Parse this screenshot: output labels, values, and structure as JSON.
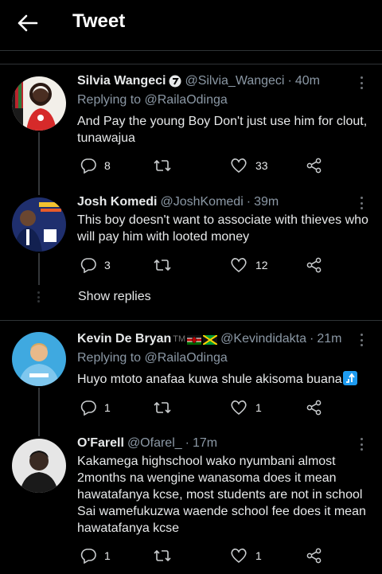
{
  "header": {
    "title": "Tweet"
  },
  "colors": {
    "accent": "#1d9bf0",
    "muted": "#8b98a5",
    "background": "#000000",
    "divider": "#2f3336"
  },
  "tweets": [
    {
      "name": "Silvia Wangeci",
      "verified_badge": "circle-badge",
      "handle": "@Silvia_Wangeci",
      "sep": "·",
      "time": "40m",
      "replying_prefix": "Replying to",
      "replying_to": "@RailaOdinga",
      "text": "And Pay the young Boy Don't just use him for clout, tunawajua",
      "replies": "8",
      "retweets": "",
      "likes": "33"
    },
    {
      "name": "Josh Komedi",
      "handle": "@JoshKomedi",
      "sep": "·",
      "time": "39m",
      "text": "This boy doesn't want to associate with thieves who will pay him with looted money",
      "replies": "3",
      "retweets": "",
      "likes": "12"
    },
    {
      "name": "Kevin De Bryan",
      "name_suffix": "TM",
      "flags": [
        "kenya-flag",
        "jamaica-flag"
      ],
      "handle": "@Kevindidakta",
      "sep": "·",
      "time": "21m",
      "replying_prefix": "Replying to",
      "replying_to": "@RailaOdinga",
      "text": "Huyo mtoto anafaa kuwa shule akisoma buana",
      "emoji": "up-arrow-emoji",
      "replies": "1",
      "retweets": "",
      "likes": "1"
    },
    {
      "name": "O'Farell",
      "handle": "@Ofarel_",
      "sep": "·",
      "time": "17m",
      "text": "Kakamega highschool wako nyumbani almost 2months na wengine wanasoma does it mean hawatafanya kcse, most students are not in school Sai wamefukuzwa waende school fee does it mean hawatafanya kcse",
      "replies": "1",
      "retweets": "",
      "likes": "1"
    }
  ],
  "show_replies": "Show replies"
}
